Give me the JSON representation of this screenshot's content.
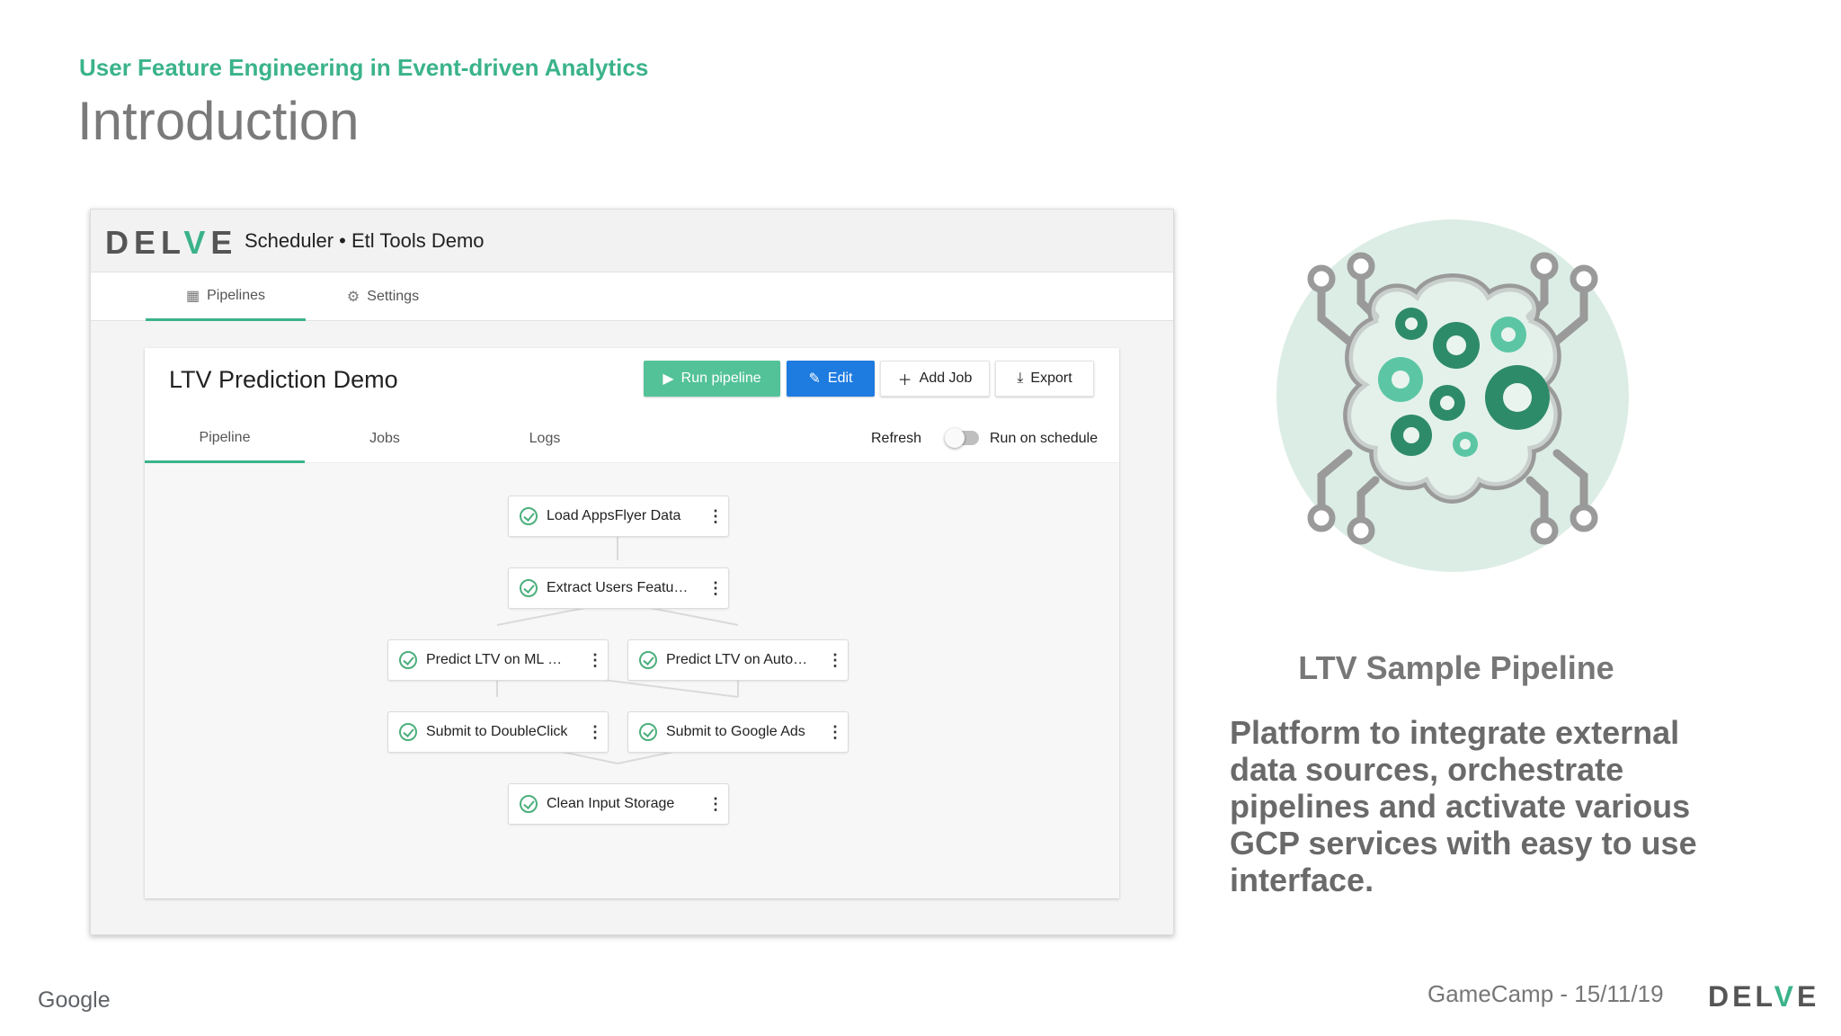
{
  "slide": {
    "subtitle": "User Feature Engineering in Event-driven Analytics",
    "title": "Introduction"
  },
  "app": {
    "logo": {
      "prefix": "DEL",
      "accent": "V",
      "suffix": "E"
    },
    "title": "Scheduler • Etl Tools Demo",
    "nav": [
      {
        "label": "Pipelines",
        "icon": "table-icon"
      },
      {
        "label": "Settings",
        "icon": "gear-icon"
      }
    ],
    "card": {
      "title": "LTV Prediction Demo",
      "buttons": {
        "run": "Run pipeline",
        "edit": "Edit",
        "add_job": "Add Job",
        "export": "Export"
      },
      "tabs": [
        "Pipeline",
        "Jobs",
        "Logs"
      ],
      "refresh": "Refresh",
      "run_on_schedule": "Run on schedule",
      "run_on_schedule_enabled": false
    },
    "nodes": [
      {
        "label": "Load AppsFlyer Data",
        "status": "success"
      },
      {
        "label": "Extract Users Featu…",
        "status": "success"
      },
      {
        "label": "Predict LTV on ML …",
        "status": "success"
      },
      {
        "label": "Predict LTV on Auto…",
        "status": "success"
      },
      {
        "label": "Submit to DoubleClick",
        "status": "success"
      },
      {
        "label": "Submit to Google Ads",
        "status": "success"
      },
      {
        "label": "Clean Input Storage",
        "status": "success"
      }
    ]
  },
  "right": {
    "heading": "LTV Sample Pipeline",
    "description": "Platform to integrate external data sources, orchestrate pipelines and activate various GCP services with easy to use interface."
  },
  "footer": {
    "google": "Google",
    "event": "GameCamp - 15/11/19",
    "logo": {
      "prefix": "DEL",
      "accent": "V",
      "suffix": "E"
    }
  },
  "colors": {
    "accent": "#3bb38a",
    "run_button": "#53c299",
    "edit_button": "#1e7be0",
    "illustration_bg": "#dcede5",
    "gear_dark": "#2e8b69",
    "gear_light": "#5cc6a4",
    "circuit": "#9a9a9a"
  }
}
